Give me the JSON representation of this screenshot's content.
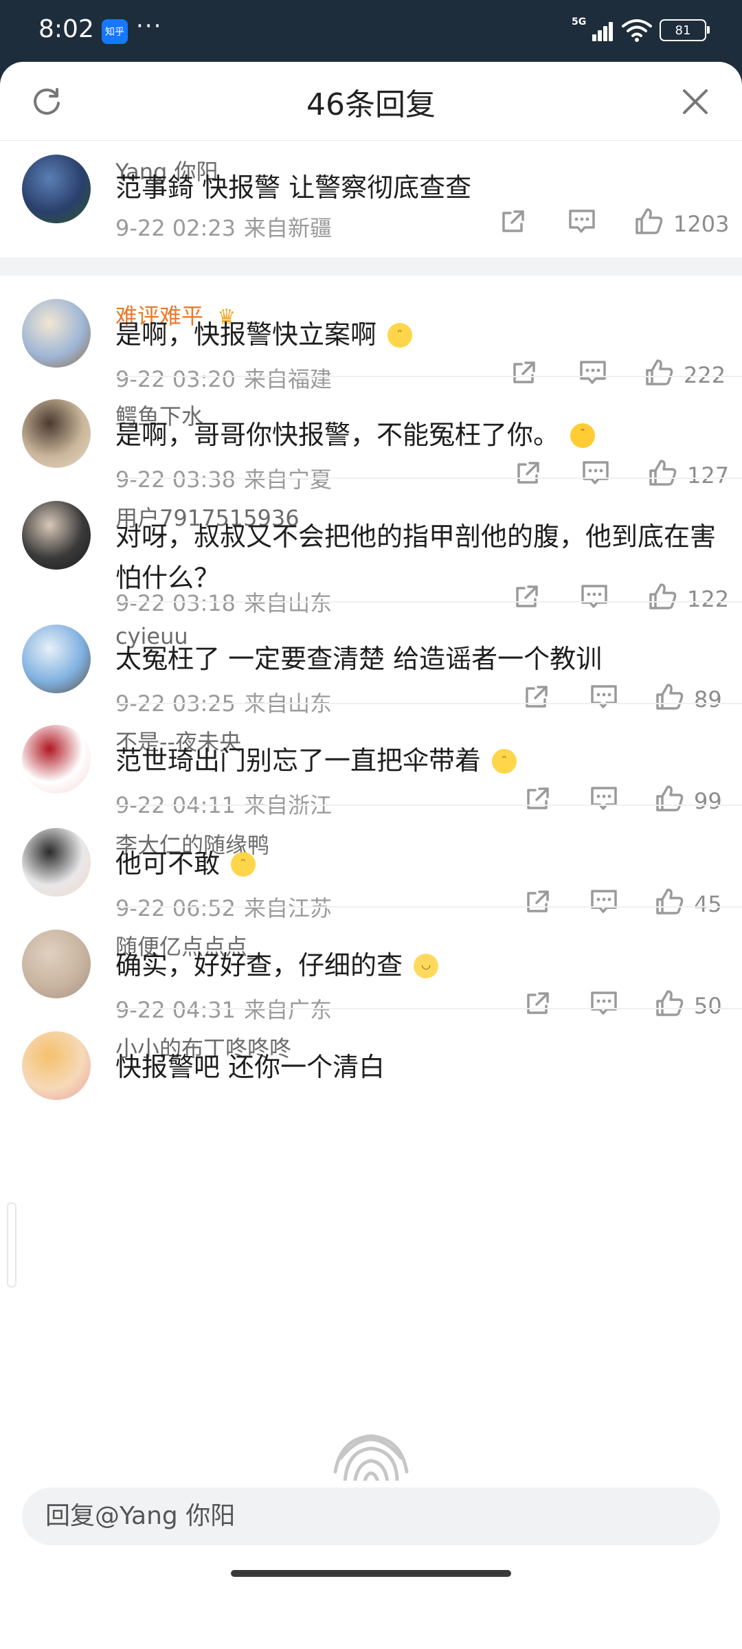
{
  "status_bar": {
    "time": "8:02",
    "app_badge": "知乎",
    "more": "···",
    "network": "5G",
    "battery": "81"
  },
  "header": {
    "title": "46条回复"
  },
  "comments": [
    {
      "user": "Yang 你阳",
      "text": "范事錡 快报警 让警察彻底查查",
      "time": "9-22 02:23",
      "location": "来自新疆",
      "likes": "1203",
      "avatar_colors": [
        "#2a3f6b",
        "#5a7fb5",
        "#2e5a2a"
      ]
    },
    {
      "user": "难评难平",
      "user_color": "#e87a2c",
      "badge": "crown-icon",
      "text": "是啊，快报警快立案啊",
      "emoji": "doge-emoji",
      "time": "9-22 03:20",
      "location": "来自福建",
      "likes": "222",
      "avatar_colors": [
        "#9fb7d6",
        "#f2e6d2",
        "#8a6a4a"
      ]
    },
    {
      "user": "鳄鱼下水",
      "text": "是啊，哥哥你快报警，不能冤枉了你。",
      "emoji": "cry-emoji",
      "time": "9-22 03:38",
      "location": "来自宁夏",
      "likes": "127",
      "avatar_colors": [
        "#c9b59a",
        "#4a3a30",
        "#e8dcc8"
      ]
    },
    {
      "user": "用户7917515936",
      "text": "对呀，叔叔又不会把他的指甲剖他的腹，他到底在害怕什么？",
      "time": "9-22 03:18",
      "location": "来自山东",
      "likes": "122",
      "avatar_colors": [
        "#3a3a3a",
        "#d8c8b8",
        "#1a1a1a"
      ]
    },
    {
      "user": "cyieuu",
      "text": "太冤枉了  一定要查清楚  给造谣者一个教训",
      "time": "9-22 03:25",
      "location": "来自山东",
      "likes": "89",
      "avatar_colors": [
        "#7fb0e0",
        "#e8f0f8",
        "#5a4a3a"
      ]
    },
    {
      "user": "不是--夜未央",
      "text": "范世琦出门别忘了一直把伞带着",
      "emoji": "doge-emoji",
      "time": "9-22 04:11",
      "location": "来自浙江",
      "likes": "99",
      "avatar_colors": [
        "#ffffff",
        "#b01822",
        "#f4d4d4"
      ]
    },
    {
      "user": "李大仁的随缘鸭",
      "text": "他可不敢",
      "emoji": "doge-emoji",
      "time": "9-22 06:52",
      "location": "来自江苏",
      "likes": "45",
      "avatar_colors": [
        "#e8e8ea",
        "#2a2a2a",
        "#f0d8c8"
      ]
    },
    {
      "user": "随便亿点点点_",
      "text": "确实，好好查，仔细的查",
      "emoji": "smile-emoji",
      "time": "9-22 04:31",
      "location": "来自广东",
      "likes": "50",
      "avatar_colors": [
        "#c8b4a0",
        "#e0d0c0",
        "#a89080"
      ]
    },
    {
      "user": "小小的布丁咚咚咚",
      "text": "快报警吧 还你一个清白",
      "avatar_colors": [
        "#f6d9b8",
        "#f5c16c",
        "#e9a0a0"
      ]
    }
  ],
  "reply_box": {
    "placeholder": "回复@Yang 你阳"
  }
}
